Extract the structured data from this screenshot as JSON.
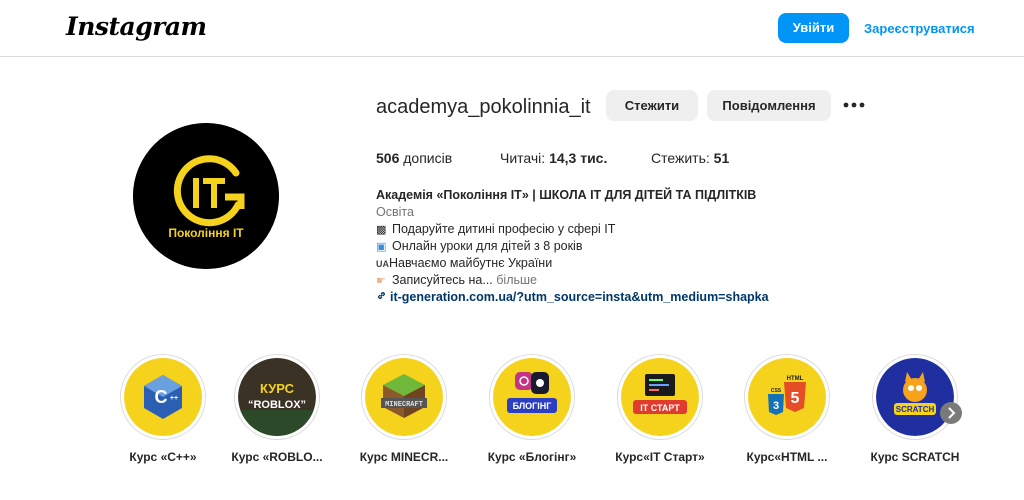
{
  "header": {
    "logo_text": "Instagram",
    "login_label": "Увійти",
    "signup_label": "Зареєструватися"
  },
  "profile": {
    "username": "academya_pokolinnia_it",
    "follow_label": "Стежити",
    "message_label": "Повідомлення",
    "avatar_text": "Покоління ІТ",
    "avatar_mark": "IT",
    "stats": {
      "posts_value": "506",
      "posts_label": "дописів",
      "followers_label": "Читачі:",
      "followers_value": "14,3 тис.",
      "following_label": "Стежить:",
      "following_value": "51"
    },
    "bio": {
      "name": "Академія «Покоління ІТ» | ШКОЛА ІТ ДЛЯ ДІТЕЙ ТА ПІДЛІТКІВ",
      "category": "Освіта",
      "line1": "Подаруйте дитині професію у сфері ІТ",
      "line2": "Онлайн уроки для дітей з 8 років",
      "line3_flag": "UA",
      "line3": "Навчаємо майбутнє України",
      "line4": "Записуйтесь на...",
      "more_label": "більше",
      "link": "it-generation.com.ua/?utm_source=insta&utm_medium=shapka"
    }
  },
  "highlights": [
    {
      "label": "Курс «С++»",
      "art_text": "C++",
      "color": "#f5d21b"
    },
    {
      "label": "Курс «ROBLO...",
      "art_text": "КУРС “ROBLOX”",
      "color": "#3a3a3a"
    },
    {
      "label": "Курс MINECR...",
      "art_text": "MINECRAFT",
      "color": "#f5d21b"
    },
    {
      "label": "Курс «Блогінг»",
      "art_text": "БЛОГІНГ",
      "color": "#f5d21b"
    },
    {
      "label": "Курс«IT Старт»",
      "art_text": "IT СТАРТ",
      "color": "#f5d21b"
    },
    {
      "label": "Курс«HTML ...",
      "art_text": "HTML CSS",
      "color": "#f5d21b"
    },
    {
      "label": "Курс SCRATCH",
      "art_text": "SCRATCH",
      "color": "#1f2fa0"
    }
  ],
  "icons": {
    "more": "more-horizontal-icon",
    "next": "chevron-right-icon",
    "link": "link-icon"
  }
}
